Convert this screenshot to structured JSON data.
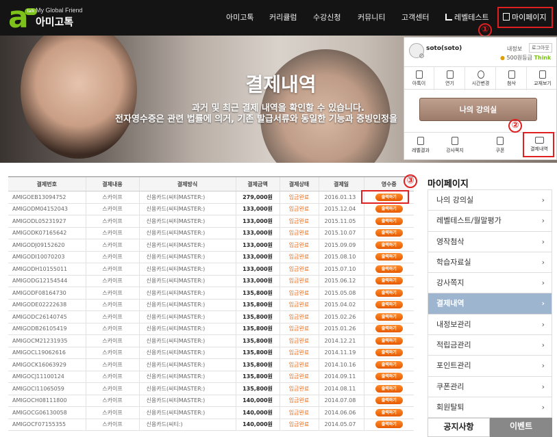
{
  "header": {
    "logo_sub": "My Global Friend",
    "logo_main": "아미고톡",
    "logo_letter": "a",
    "logo_badge": "talk",
    "nav": [
      "아미고톡",
      "커리큘럼",
      "수강신청",
      "커뮤니티",
      "고객센터",
      "레벨테스트"
    ],
    "mypage": "마이페이지"
  },
  "hero": {
    "title": "결제내역",
    "desc1": "과거 및 최근 결제 내역을 확인할 수 있습니다.",
    "desc2": "전자영수증은 관련 법률에 의거, 기존 발급서류와 동일한 기능과 증빙인정을"
  },
  "panel": {
    "username": "soto(soto)",
    "myinfo": "내정보",
    "logout": "로그아웃",
    "grade_points": "500원",
    "grade_level": "등급",
    "grade_name": "Think",
    "quick": [
      "아톡이",
      "연기",
      "시간변경",
      "첨삭",
      "교재보기"
    ],
    "lecture_button": "나의 강의실",
    "bottom": [
      "레벨결과",
      "강사쪽지",
      "쿠폰",
      "결제내역"
    ]
  },
  "annotations": [
    "①",
    "②",
    "③"
  ],
  "table": {
    "headers": [
      "결제번호",
      "결제내용",
      "결제방식",
      "결제금액",
      "결제상태",
      "결제일",
      "영수증"
    ],
    "print_label": "출력하기",
    "rows": [
      [
        "AMIGOEB13094752",
        "스카이프",
        "신용카드(씨티MASTER:)",
        "279,000원",
        "입금완료",
        "2016.01.13"
      ],
      [
        "AMIGODM04152043",
        "스카이프",
        "신용카드(씨티MASTER:)",
        "133,000원",
        "입금완료",
        "2015.12.04"
      ],
      [
        "AMIGODL05231927",
        "스카이프",
        "신용카드(씨티MASTER:)",
        "133,000원",
        "입금완료",
        "2015.11.05"
      ],
      [
        "AMIGODK07165642",
        "스카이프",
        "신용카드(씨티MASTER:)",
        "133,000원",
        "입금완료",
        "2015.10.07"
      ],
      [
        "AMIGODJ09152620",
        "스카이프",
        "신용카드(씨티MASTER:)",
        "133,000원",
        "입금완료",
        "2015.09.09"
      ],
      [
        "AMIGODI10070203",
        "스카이프",
        "신용카드(씨티MASTER:)",
        "133,000원",
        "입금완료",
        "2015.08.10"
      ],
      [
        "AMIGODH10155011",
        "스카이프",
        "신용카드(씨티MASTER:)",
        "133,000원",
        "입금완료",
        "2015.07.10"
      ],
      [
        "AMIGODG12154544",
        "스카이프",
        "신용카드(씨티MASTER:)",
        "133,000원",
        "입금완료",
        "2015.06.12"
      ],
      [
        "AMIGODF08164730",
        "스카이프",
        "신용카드(씨티MASTER:)",
        "135,800원",
        "입금완료",
        "2015.05.08"
      ],
      [
        "AMIGODE02222638",
        "스카이프",
        "신용카드(씨티MASTER:)",
        "135,800원",
        "입금완료",
        "2015.04.02"
      ],
      [
        "AMIGODC26140745",
        "스카이프",
        "신용카드(씨티MASTER:)",
        "135,800원",
        "입금완료",
        "2015.02.26"
      ],
      [
        "AMIGODB26105419",
        "스카이프",
        "신용카드(씨티MASTER:)",
        "135,800원",
        "입금완료",
        "2015.01.26"
      ],
      [
        "AMIGOCM21231935",
        "스카이프",
        "신용카드(씨티MASTER:)",
        "135,800원",
        "입금완료",
        "2014.12.21"
      ],
      [
        "AMIGOCL19062616",
        "스카이프",
        "신용카드(씨티MASTER:)",
        "135,800원",
        "입금완료",
        "2014.11.19"
      ],
      [
        "AMIGOCK16063929",
        "스카이프",
        "신용카드(씨티MASTER:)",
        "135,800원",
        "입금완료",
        "2014.10.16"
      ],
      [
        "AMIGOCJ11100124",
        "스카이프",
        "신용카드(씨티MASTER:)",
        "135,800원",
        "입금완료",
        "2014.09.11"
      ],
      [
        "AMIGOCI11065059",
        "스카이프",
        "신용카드(씨티MASTER:)",
        "135,800원",
        "입금완료",
        "2014.08.11"
      ],
      [
        "AMIGOCH08111800",
        "스카이프",
        "신용카드(씨티MASTER:)",
        "140,000원",
        "입금완료",
        "2014.07.08"
      ],
      [
        "AMIGOCG06130058",
        "스카이프",
        "신용카드(씨티MASTER:)",
        "140,000원",
        "입금완료",
        "2014.06.06"
      ],
      [
        "AMIGOCF07155355",
        "스카이프",
        "신용카드(씨티:)",
        "140,000원",
        "입금완료",
        "2014.05.07"
      ]
    ]
  },
  "sidebar": {
    "title": "마이페이지",
    "items": [
      "나의 강의실",
      "레벨테스트/월말평가",
      "영작첨삭",
      "학습자료실",
      "강사쪽지",
      "결제내역",
      "내정보관리",
      "적립금관리",
      "포인트관리",
      "쿠폰관리",
      "회원탈퇴"
    ],
    "active_index": 5,
    "tabs": [
      "공지사항",
      "이벤트"
    ]
  },
  "colors": {
    "brand_green": "#7cc21a",
    "annotation_red": "#e02020",
    "status_orange": "#e86a1a",
    "active_menu": "#9db5cf"
  }
}
